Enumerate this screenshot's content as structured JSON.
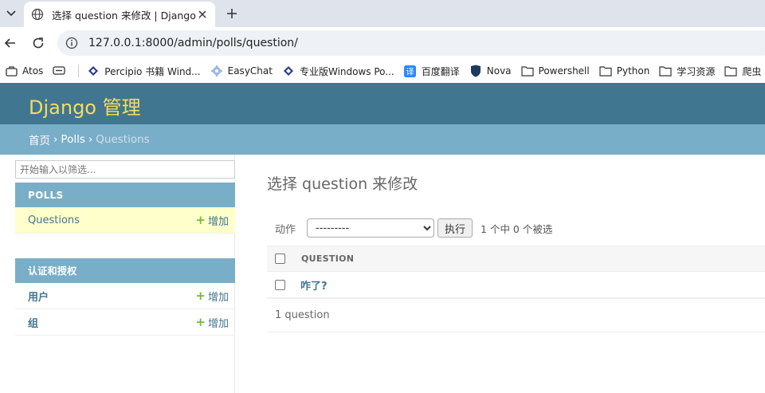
{
  "browser": {
    "tab_title": "选择 question 来修改 | Django 站",
    "url": "127.0.0.1:8000/admin/polls/question/",
    "bookmarks": [
      {
        "label": "Atos",
        "icon": "briefcase-icon"
      },
      {
        "label": "",
        "icon": "display-icon"
      },
      {
        "label": "Percipio 书籍 Wind...",
        "icon": "diamond-icon"
      },
      {
        "label": "EasyChat",
        "icon": "gear-icon"
      },
      {
        "label": "专业版Windows Po...",
        "icon": "diamond-icon"
      },
      {
        "label": "百度翻译",
        "icon": "translate-icon"
      },
      {
        "label": "Nova",
        "icon": "shield-icon"
      },
      {
        "label": "Powershell",
        "icon": "folder-icon"
      },
      {
        "label": "Python",
        "icon": "folder-icon"
      },
      {
        "label": "学习资源",
        "icon": "folder-icon"
      },
      {
        "label": "爬虫",
        "icon": "folder-icon"
      }
    ]
  },
  "django": {
    "brand": "Django 管理",
    "breadcrumbs": {
      "home": "首页",
      "app": "Polls",
      "current": "Questions"
    },
    "sidebar": {
      "filter_placeholder": "开始输入以筛选...",
      "modules": [
        {
          "caption": "POLLS",
          "rows": [
            {
              "label": "Questions",
              "add": "增加",
              "selected": true
            }
          ]
        },
        {
          "caption": "认证和授权",
          "rows": [
            {
              "label": "用户",
              "add": "增加",
              "selected": false
            },
            {
              "label": "组",
              "add": "增加",
              "selected": false
            }
          ]
        }
      ]
    },
    "main": {
      "title": "选择 question 来修改",
      "action_label": "动作",
      "action_selected": "---------",
      "go_label": "执行",
      "counter": "1 个中 0 个被选",
      "column_header": "QUESTION",
      "rows": [
        {
          "question": "咋了?"
        }
      ],
      "paginator": "1 question"
    }
  },
  "colors": {
    "header_bg": "#417690",
    "breadcrumb_bg": "#79aec8",
    "brand_yellow": "#f5dd5d",
    "link": "#417690",
    "selected_row": "#ffffcc",
    "add_plus": "#70bf2b"
  }
}
